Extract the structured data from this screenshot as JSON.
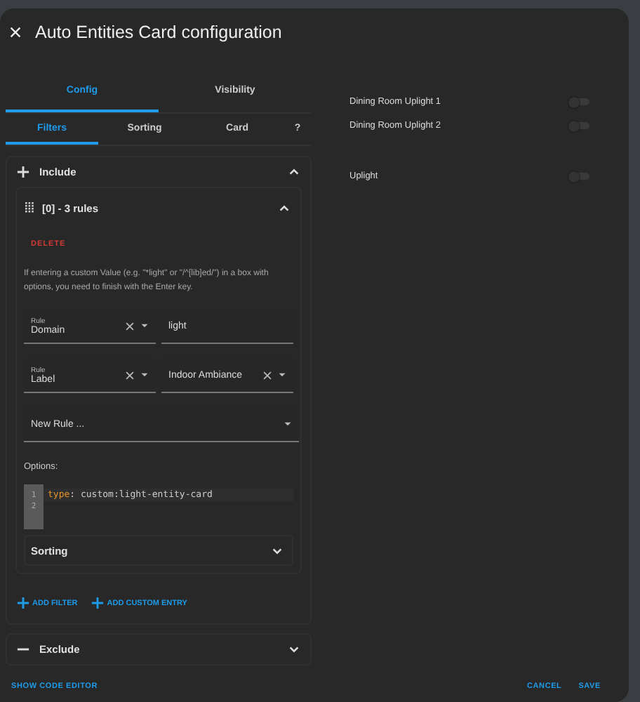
{
  "dialog": {
    "title": "Auto Entities Card configuration"
  },
  "tabs": [
    {
      "label": "Config",
      "selected": true
    },
    {
      "label": "Visibility",
      "selected": false
    }
  ],
  "subtabs": [
    {
      "label": "Filters",
      "selected": true
    },
    {
      "label": "Sorting",
      "selected": false
    },
    {
      "label": "Card",
      "selected": false
    },
    {
      "label": "?",
      "selected": false
    }
  ],
  "panels": [
    {
      "kind": "include",
      "title": "Include",
      "expanded": true,
      "groups": [
        {
          "title": "[0] - 3 rules",
          "expanded": true,
          "delete_label": "DELETE",
          "hint": "If entering a custom Value (e.g. \"*light\" or \"/^[lib]ed/\") in a box with options, you need to finish with the Enter key.",
          "rules": [
            {
              "label": "Rule",
              "type": "Domain",
              "value": "light",
              "value_clearable": false
            },
            {
              "label": "Rule",
              "type": "Label",
              "value": "Indoor Ambiance",
              "value_clearable": true
            }
          ],
          "new_rule": {
            "placeholder": "New Rule ..."
          },
          "options_label": "Options:",
          "code_lines": [
            {
              "number": "1",
              "key": "type",
              "rest": ": custom:light-entity-card"
            },
            {
              "number": "2"
            }
          ],
          "sorting": {
            "title": "Sorting",
            "expanded": false
          }
        }
      ],
      "actions": [
        "ADD FILTER",
        "ADD CUSTOM ENTRY"
      ]
    },
    {
      "kind": "exclude",
      "title": "Exclude",
      "expanded": false
    }
  ],
  "preview_groups": [
    {
      "entities": [
        {
          "name": "Dining Room Uplight 1",
          "on": false
        },
        {
          "name": "Dining Room Uplight 2",
          "on": false
        }
      ]
    },
    {
      "entities": [
        {
          "name": "Uplight",
          "on": false
        }
      ]
    }
  ],
  "footer": {
    "code_editor_label": "SHOW CODE EDITOR",
    "buttons": [
      "CANCEL",
      "SAVE"
    ]
  }
}
